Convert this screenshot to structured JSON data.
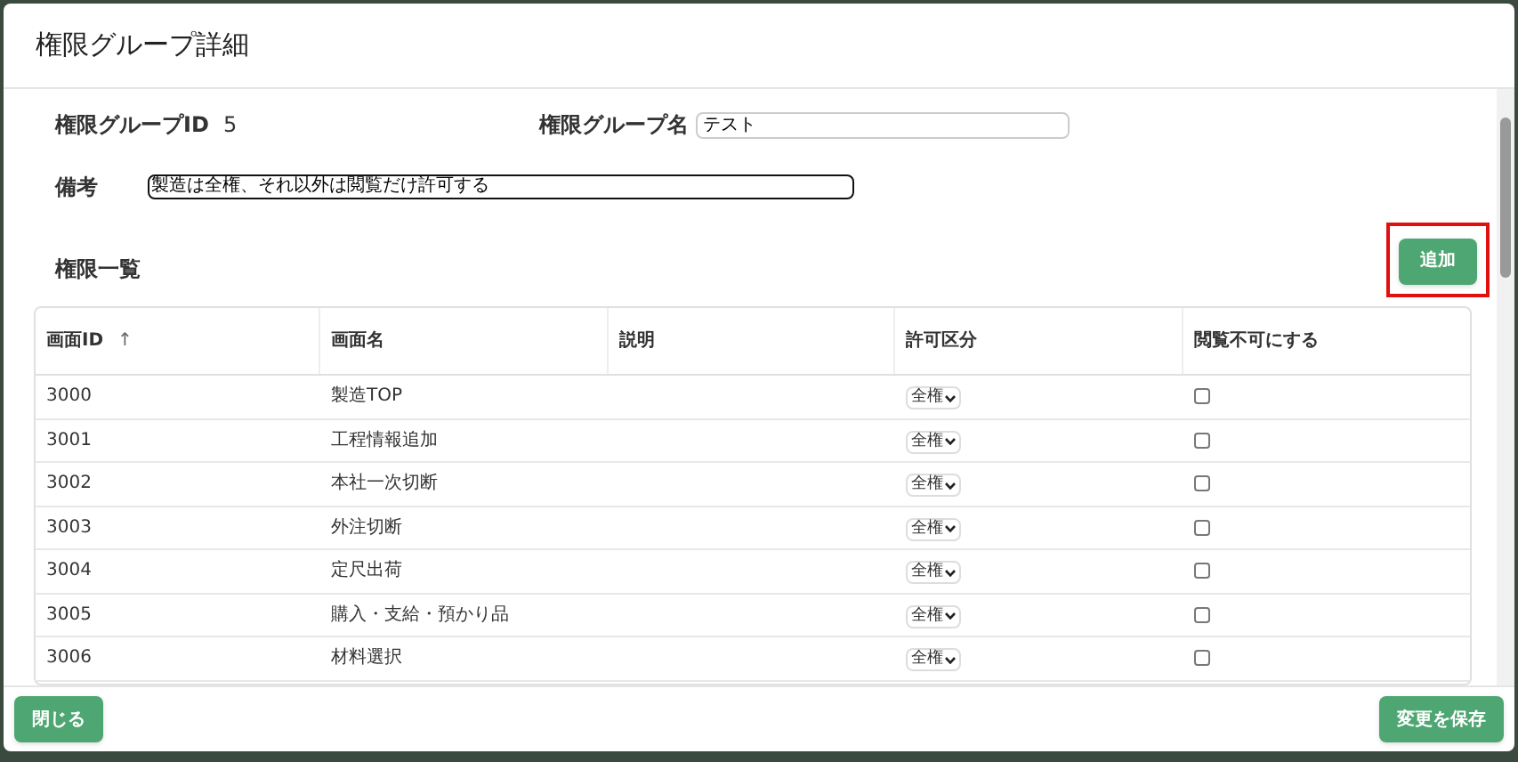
{
  "dialog": {
    "title": "権限グループ詳細"
  },
  "group_id": {
    "label": "権限グループID",
    "value": "5"
  },
  "group_name": {
    "label": "権限グループ名",
    "value": "テスト"
  },
  "remarks": {
    "label": "備考",
    "value": "製造は全権、それ以外は閲覧だけ許可する"
  },
  "permissions": {
    "label": "権限一覧",
    "add_button": {
      "label": "追加",
      "highlighted": true
    }
  },
  "table": {
    "columns": [
      {
        "label": "画面ID",
        "sort_icon": "↑"
      },
      {
        "label": "画面名"
      },
      {
        "label": "説明"
      },
      {
        "label": "許可区分"
      },
      {
        "label": "閲覧不可にする"
      }
    ],
    "rows": [
      {
        "id": "3000",
        "name": "製造TOP",
        "description": "",
        "permission": "全権",
        "hidden": false
      },
      {
        "id": "3001",
        "name": "工程情報追加",
        "description": "",
        "permission": "全権",
        "hidden": false
      },
      {
        "id": "3002",
        "name": "本社一次切断",
        "description": "",
        "permission": "全権",
        "hidden": false
      },
      {
        "id": "3003",
        "name": "外注切断",
        "description": "",
        "permission": "全権",
        "hidden": false
      },
      {
        "id": "3004",
        "name": "定尺出荷",
        "description": "",
        "permission": "全権",
        "hidden": false
      },
      {
        "id": "3005",
        "name": "購入・支給・預かり品",
        "description": "",
        "permission": "全権",
        "hidden": false
      },
      {
        "id": "3006",
        "name": "材料選択",
        "description": "",
        "permission": "全権",
        "hidden": false
      }
    ]
  },
  "footer": {
    "close_button": "閉じる",
    "save_button": "変更を保存"
  }
}
